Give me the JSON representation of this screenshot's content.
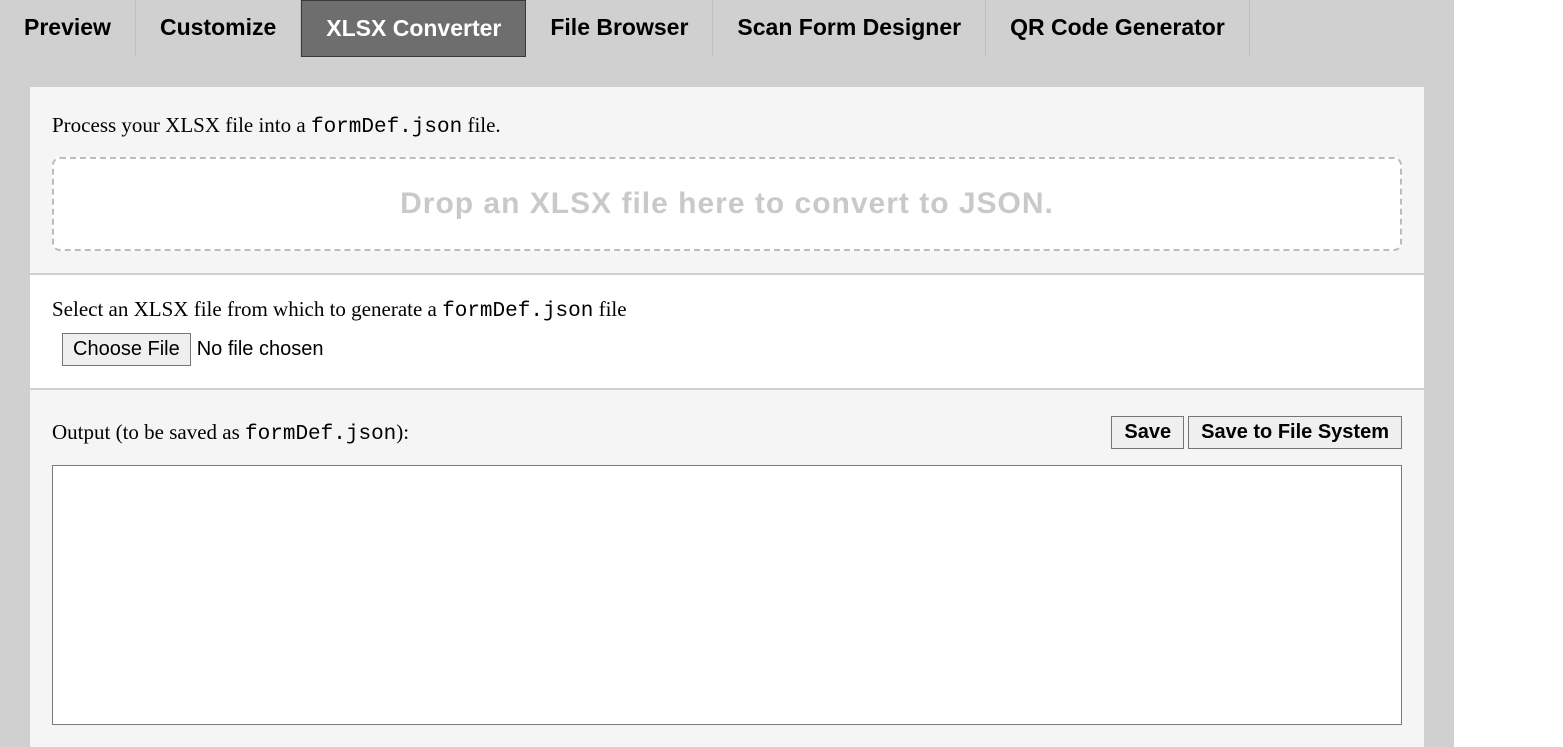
{
  "tabs": [
    {
      "label": "Preview",
      "active": false
    },
    {
      "label": "Customize",
      "active": false
    },
    {
      "label": "XLSX Converter",
      "active": true
    },
    {
      "label": "File Browser",
      "active": false
    },
    {
      "label": "Scan Form Designer",
      "active": false
    },
    {
      "label": "QR Code Generator",
      "active": false
    }
  ],
  "intro": {
    "prefix": "Process your XLSX file into a ",
    "code": "formDef.json",
    "suffix": " file."
  },
  "dropzone": {
    "text": "Drop an XLSX file here to convert to JSON."
  },
  "select": {
    "prefix": "Select an XLSX file from which to generate a ",
    "code": "formDef.json",
    "suffix": " file"
  },
  "file_input": {
    "button": "Choose File",
    "status": "No file chosen"
  },
  "output": {
    "label_prefix": "Output (to be saved as ",
    "label_code": "formDef.json",
    "label_suffix": "):",
    "save_button": "Save",
    "save_fs_button": "Save to File System",
    "content": ""
  }
}
